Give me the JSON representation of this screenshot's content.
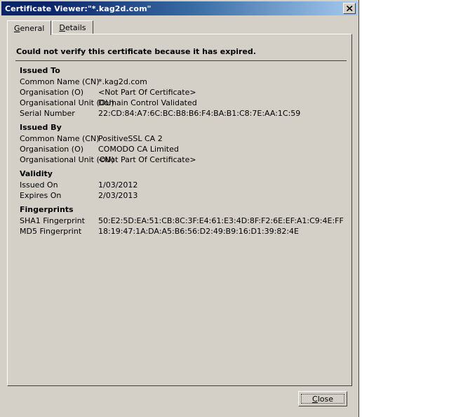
{
  "window": {
    "title": "Certificate Viewer:\"*.kag2d.com\"",
    "close_icon": "close-x-icon"
  },
  "tabs": [
    {
      "label": "General",
      "accel": "G",
      "selected": true
    },
    {
      "label": "Details",
      "accel": "D",
      "selected": false
    }
  ],
  "content": {
    "warning": "Could not verify this certificate because it has expired.",
    "sections": [
      {
        "title": "Issued To",
        "rows": [
          {
            "label": "Common Name (CN)",
            "value": "*.kag2d.com"
          },
          {
            "label": "Organisation (O)",
            "value": "<Not Part Of Certificate>"
          },
          {
            "label": "Organisational Unit (OU)",
            "value": "Domain Control Validated"
          },
          {
            "label": "Serial Number",
            "value": "22:CD:84:A7:6C:BC:B8:B6:F4:BA:B1:C8:7E:AA:1C:59"
          }
        ]
      },
      {
        "title": "Issued By",
        "rows": [
          {
            "label": "Common Name (CN)",
            "value": "PositiveSSL CA 2"
          },
          {
            "label": "Organisation (O)",
            "value": "COMODO CA Limited"
          },
          {
            "label": "Organisational Unit (OU)",
            "value": "<Not Part Of Certificate>"
          }
        ]
      },
      {
        "title": "Validity",
        "rows": [
          {
            "label": "Issued On",
            "value": "1/03/2012"
          },
          {
            "label": "Expires On",
            "value": "2/03/2013"
          }
        ]
      },
      {
        "title": "Fingerprints",
        "rows": [
          {
            "label": "SHA1 Fingerprint",
            "value": "50:E2:5D:EA:51:CB:8C:3F:E4:61:E3:4D:8F:F2:6E:EF:A1:C9:4E:FF"
          },
          {
            "label": "MD5 Fingerprint",
            "value": "18:19:47:1A:DA:A5:B6:56:D2:49:B9:16:D1:39:82:4E"
          }
        ]
      }
    ]
  },
  "footer": {
    "close_label": "Close",
    "close_accel": "C"
  },
  "colors": {
    "dialog_face": "#d4d0c8",
    "titlebar_start": "#0a246a",
    "titlebar_end": "#a6caf0",
    "shadow": "#404040",
    "highlight": "#ffffff"
  }
}
